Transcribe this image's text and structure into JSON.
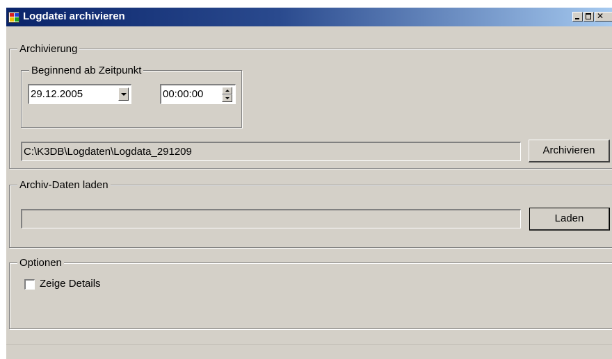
{
  "window": {
    "title": "Logdatei archivieren",
    "caption_buttons": [
      "minimize",
      "maximize",
      "close"
    ]
  },
  "archivierung": {
    "group_label": "Archivierung",
    "subgroup_label": "Beginnend ab Zeitpunkt",
    "date_value": "29.12.2005",
    "time_value": "00:00:00",
    "path_value": "C:\\K3DB\\Logdaten\\Logdata_291209",
    "button_label": "Archivieren"
  },
  "laden": {
    "group_label": "Archiv-Daten laden",
    "path_value": "",
    "button_label": "Laden"
  },
  "optionen": {
    "group_label": "Optionen",
    "checkbox_label": "Zeige Details",
    "checkbox_checked": false
  },
  "colors": {
    "titlebar_start": "#0a246a",
    "titlebar_end": "#a6caf0",
    "window_bg": "#d4d0c8"
  }
}
